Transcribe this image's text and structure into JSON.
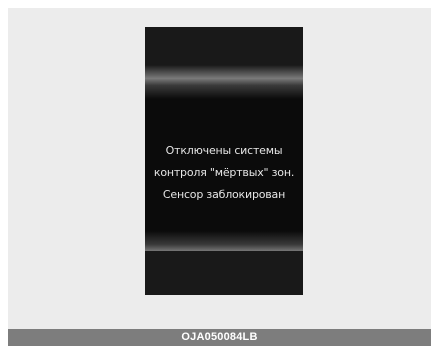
{
  "display": {
    "message_lines": [
      "Отключены системы",
      "контроля \"мёртвых\" зон.",
      "Сенсор заблокирован"
    ]
  },
  "caption": {
    "code": "OJA050084LB"
  },
  "colors": {
    "panel": "#ececec",
    "screen": "#0b0b0b",
    "text": "#e6e6e6",
    "caption_bar": "#7d7d7d"
  }
}
